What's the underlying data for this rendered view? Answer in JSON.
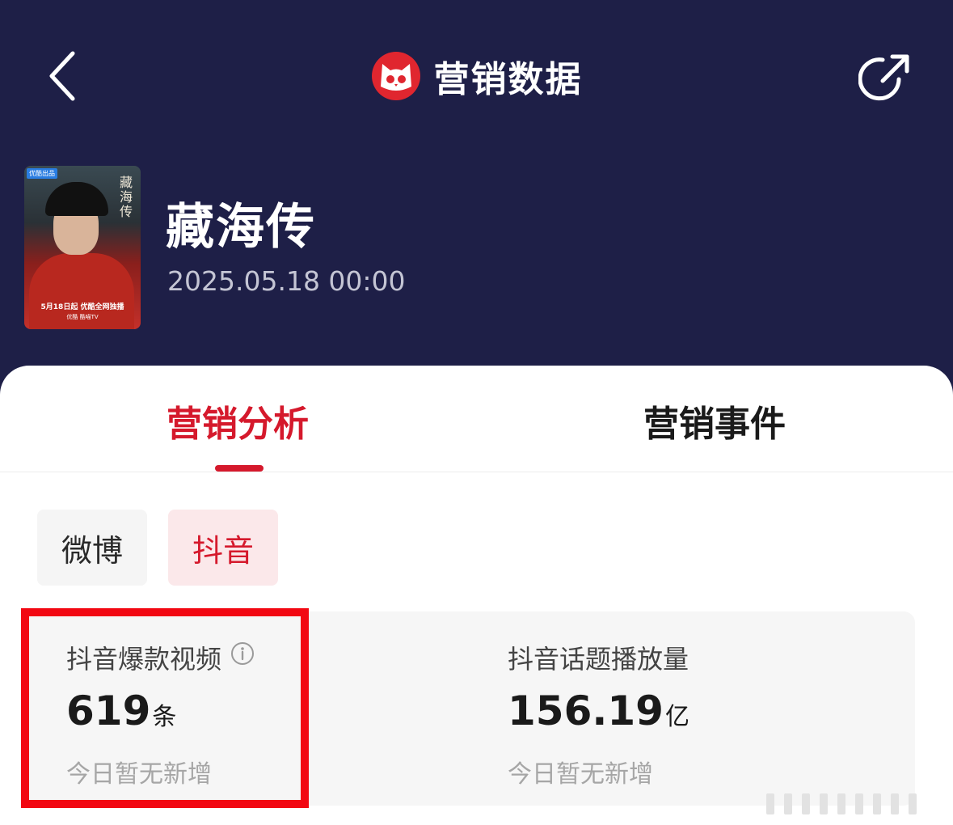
{
  "header": {
    "title": "营销数据",
    "colors": {
      "background": "#1e1f47",
      "accent": "#d5192c",
      "logo": "#e0262f"
    }
  },
  "movie": {
    "name": "藏海传",
    "datetime": "2025.05.18 00:00",
    "poster": {
      "tag": "优酷出品",
      "title": "藏海传",
      "caption": "5月18日起 优酷全网独播",
      "brand": "优酷 酷喵TV"
    }
  },
  "tabs": [
    {
      "label": "营销分析",
      "active": true
    },
    {
      "label": "营销事件",
      "active": false
    }
  ],
  "platforms": [
    {
      "label": "微博",
      "selected": false
    },
    {
      "label": "抖音",
      "selected": true
    }
  ],
  "stats": [
    {
      "label": "抖音爆款视频",
      "value": "619",
      "unit": "条",
      "note": "今日暂无新增",
      "highlighted": true
    },
    {
      "label": "抖音话题播放量",
      "value": "156.19",
      "unit": "亿",
      "note": "今日暂无新增",
      "highlighted": false
    }
  ],
  "icons": {
    "back": "chevron-left-icon",
    "logo": "cat-logo-icon",
    "share": "share-icon",
    "info": "info-icon"
  }
}
